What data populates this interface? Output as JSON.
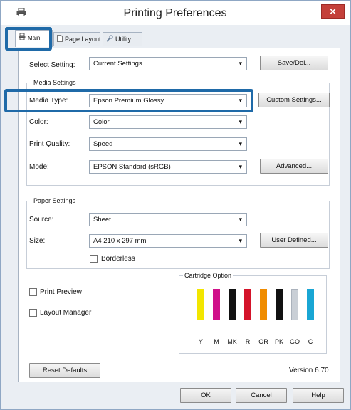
{
  "window": {
    "title": "Printing Preferences",
    "close_glyph": "×"
  },
  "tabs": [
    {
      "label": "Main",
      "icon": "printer-icon"
    },
    {
      "label": "Page Layout",
      "icon": "page-icon"
    },
    {
      "label": "Utility",
      "icon": "wrench-icon"
    }
  ],
  "select_setting": {
    "label": "Select Setting:",
    "value": "Current Settings",
    "button": "Save/Del..."
  },
  "media_settings": {
    "title": "Media Settings",
    "media_type": {
      "label": "Media Type:",
      "value": "Epson Premium Glossy"
    },
    "custom_button": "Custom Settings...",
    "color": {
      "label": "Color:",
      "value": "Color"
    },
    "print_quality": {
      "label": "Print Quality:",
      "value": "Speed"
    },
    "mode": {
      "label": "Mode:",
      "value": "EPSON Standard (sRGB)"
    },
    "advanced_button": "Advanced..."
  },
  "paper_settings": {
    "title": "Paper Settings",
    "source": {
      "label": "Source:",
      "value": "Sheet"
    },
    "size": {
      "label": "Size:",
      "value": "A4 210 x 297 mm"
    },
    "user_defined_button": "User Defined...",
    "borderless": {
      "label": "Borderless",
      "checked": false
    }
  },
  "print_preview": {
    "label": "Print Preview",
    "checked": false
  },
  "layout_manager": {
    "label": "Layout Manager",
    "checked": false
  },
  "cartridge": {
    "title": "Cartridge Option",
    "inks": [
      {
        "code": "Y",
        "color": "#f2e600"
      },
      {
        "code": "M",
        "color": "#d0118a"
      },
      {
        "code": "MK",
        "color": "#111111"
      },
      {
        "code": "R",
        "color": "#d4142a"
      },
      {
        "code": "OR",
        "color": "#f08c00"
      },
      {
        "code": "PK",
        "color": "#111111"
      },
      {
        "code": "GO",
        "color": "#c9cfd6"
      },
      {
        "code": "C",
        "color": "#19a6d4"
      }
    ]
  },
  "reset_button": "Reset Defaults",
  "version": "Version 6.70",
  "footer": {
    "ok": "OK",
    "cancel": "Cancel",
    "help": "Help"
  },
  "colors": {
    "highlight": "#1f6aa8",
    "close": "#c4403a"
  }
}
